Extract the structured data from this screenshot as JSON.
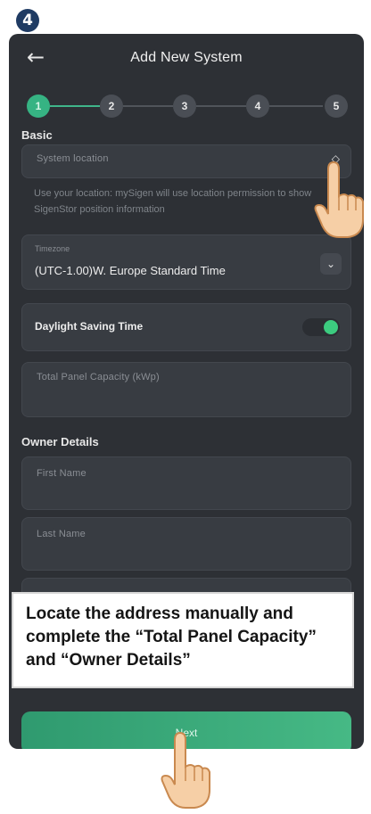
{
  "step_number": "4",
  "header": {
    "title": "Add New System",
    "back_icon": "arrow-left-icon"
  },
  "stepper": {
    "steps": [
      "1",
      "2",
      "3",
      "4",
      "5"
    ],
    "current": 1
  },
  "basic": {
    "section_label": "Basic",
    "location_placeholder": "System location",
    "location_icon": "location-pin-icon",
    "location_hint": "Use your location: mySigen will use location permission to show SigenStor position information",
    "timezone_label": "Timezone",
    "timezone_value": "(UTC-1.00)W. Europe Standard Time",
    "dst_label": "Daylight Saving Time",
    "dst_on": true,
    "capacity_placeholder": "Total Panel Capacity (kWp)"
  },
  "owner": {
    "section_label": "Owner Details",
    "first_name_placeholder": "First Name",
    "last_name_placeholder": "Last Name"
  },
  "callout_text": "Locate the address manually and complete the “Total Panel Capacity” and “Owner Details”",
  "next_label": "Next",
  "colors": {
    "accent": "#36b383",
    "background": "#2d3035",
    "field": "#383c42"
  }
}
